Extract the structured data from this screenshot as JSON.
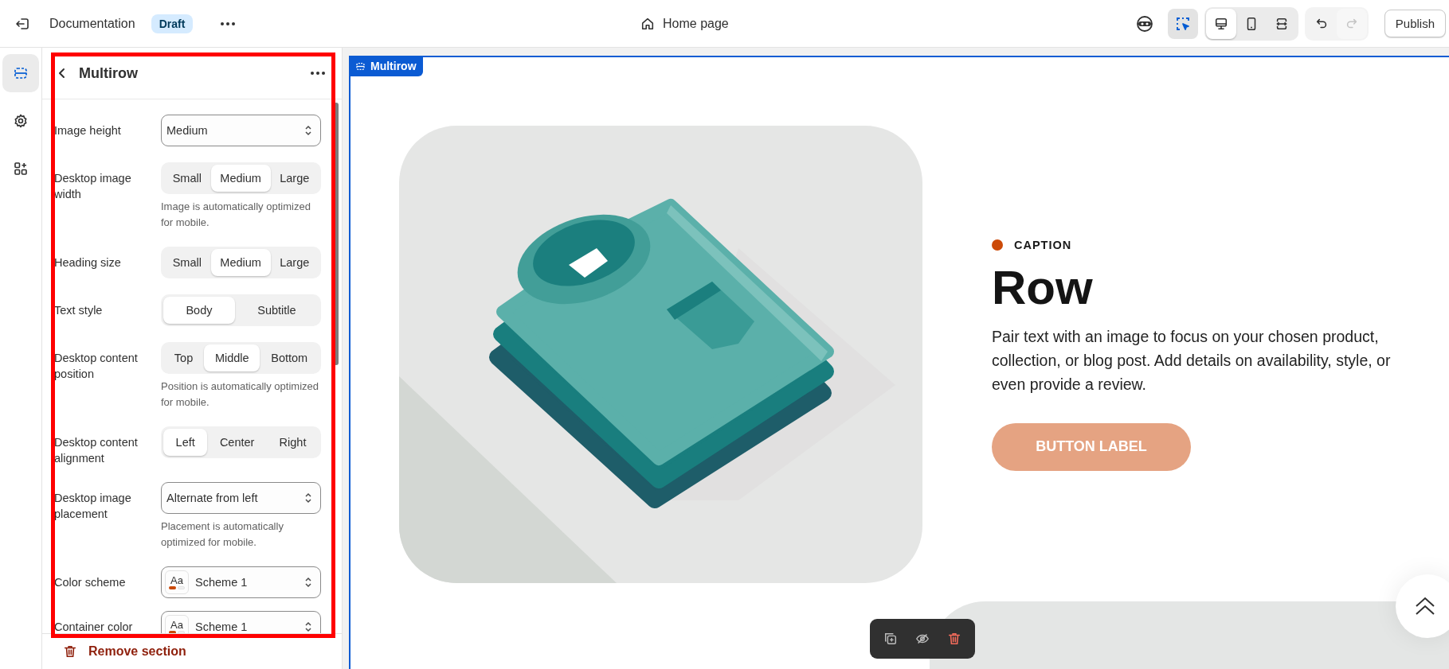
{
  "topbar": {
    "title": "Documentation",
    "badge": "Draft",
    "page": "Home page",
    "inspector": {
      "on": true
    },
    "view_modes": [
      {
        "kind": "desktop",
        "selected": true
      },
      {
        "kind": "mobile",
        "selected": false
      },
      {
        "kind": "fullwidth",
        "selected": false
      }
    ],
    "history": [
      {
        "kind": "undo",
        "disabled": false
      },
      {
        "kind": "redo",
        "disabled": true
      }
    ],
    "publish": "Publish"
  },
  "rail": [
    {
      "kind": "sections",
      "selected": true
    },
    {
      "kind": "settings",
      "selected": false
    },
    {
      "kind": "apps",
      "selected": false
    }
  ],
  "panel": {
    "title": "Multirow",
    "settings": [
      {
        "kind": "select",
        "label": "Image height",
        "value": "Medium"
      },
      {
        "kind": "segmented",
        "label": "Desktop image width",
        "options": [
          {
            "label": "Small",
            "selected": false
          },
          {
            "label": "Medium",
            "selected": true
          },
          {
            "label": "Large",
            "selected": false
          }
        ],
        "hint": "Image is automatically optimized for mobile."
      },
      {
        "kind": "segmented",
        "label": "Heading size",
        "options": [
          {
            "label": "Small",
            "selected": false
          },
          {
            "label": "Medium",
            "selected": true
          },
          {
            "label": "Large",
            "selected": false
          }
        ]
      },
      {
        "kind": "segmented",
        "label": "Text style",
        "options": [
          {
            "label": "Body",
            "selected": true
          },
          {
            "label": "Subtitle",
            "selected": false
          }
        ]
      },
      {
        "kind": "segmented",
        "label": "Desktop content position",
        "options": [
          {
            "label": "Top",
            "selected": false
          },
          {
            "label": "Middle",
            "selected": true
          },
          {
            "label": "Bottom",
            "selected": false
          }
        ],
        "hint": "Position is automatically optimized for mobile."
      },
      {
        "kind": "segmented",
        "label": "Desktop content alignment",
        "options": [
          {
            "label": "Left",
            "selected": true
          },
          {
            "label": "Center",
            "selected": false
          },
          {
            "label": "Right",
            "selected": false
          }
        ]
      },
      {
        "kind": "select",
        "label": "Desktop image placement",
        "value": "Alternate from left",
        "hint": "Placement is automatically optimized for mobile."
      },
      {
        "kind": "scheme",
        "label": "Color scheme",
        "sample": "Aa",
        "value": "Scheme 1"
      },
      {
        "kind": "scheme",
        "label": "Container color",
        "sample": "Aa",
        "value": "Scheme 1"
      }
    ],
    "remove": "Remove section"
  },
  "preview": {
    "tag": "Multirow",
    "caption": "CAPTION",
    "heading": "Row",
    "body": "Pair text with an image to focus on your chosen product, collection, or blog post. Add details on availability, style, or even provide a review.",
    "button": "BUTTON LABEL"
  }
}
